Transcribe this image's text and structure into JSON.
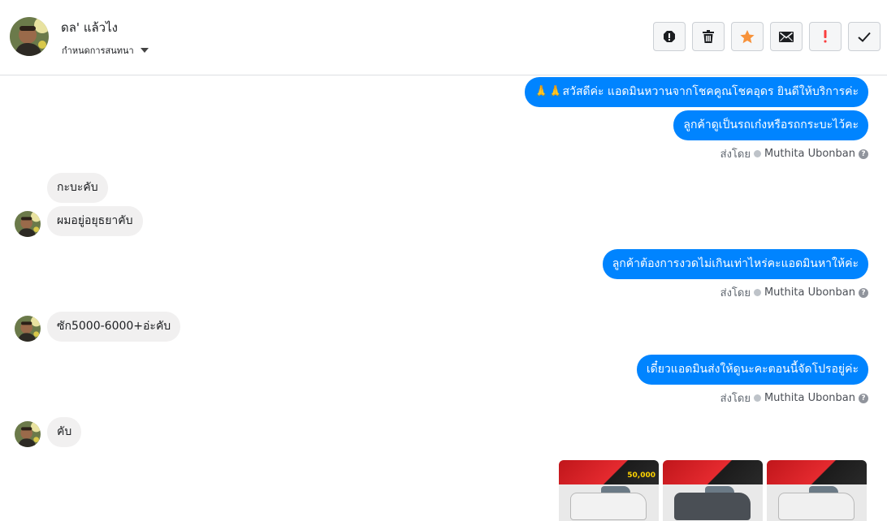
{
  "header": {
    "contact_name": "ดล' แล้วไง",
    "subtitle": "กำหนดการสนทนา",
    "toolbar": [
      {
        "name": "spam-alert-icon",
        "color": "#1c1e21"
      },
      {
        "name": "trash-icon",
        "color": "#1c1e21"
      },
      {
        "name": "star-icon",
        "color": "#f7923a"
      },
      {
        "name": "mail-icon",
        "color": "#1c1e21"
      },
      {
        "name": "exclamation-icon",
        "color": "#fa3e3e"
      },
      {
        "name": "check-icon",
        "color": "#1c1e21"
      }
    ]
  },
  "messages": {
    "out1": "🙏🙏สวัสดีค่ะ แอดมินหวานจากโชคคูณโชคอุดร ยินดีให้บริการค่ะ",
    "out2": "ลูกค้าดูเป็นรถเก๋งหรือรถกระบะไว้คะ",
    "sent_by_1_label": "ส่งโดย",
    "sent_by_1_name": "Muthita Ubonban",
    "in1": "กะบะคับ",
    "in2": "ผมอยู่อยุธยาคับ",
    "out3": "ลูกค้าต้องการงวดไม่เกินเท่าไหร่คะแอดมินหาให้ค่ะ",
    "sent_by_2_label": "ส่งโดย",
    "sent_by_2_name": "Muthita Ubonban",
    "in3": "ซัก5000-6000+อ่ะคับ",
    "out4": "เดี๋ยวแอดมินส่งให้ดูนะคะตอนนี้จัดโปรอยู่ค่ะ",
    "sent_by_3_label": "ส่งโดย",
    "sent_by_3_name": "Muthita Ubonban",
    "in4": "คับ"
  },
  "attachments": {
    "thumb1_price": "50,000",
    "car_colors": [
      "#f2f2f2",
      "#4a4f55",
      "#f0f0f0"
    ]
  },
  "colors": {
    "outgoing_bubble": "#0084ff",
    "incoming_bubble": "#f1f0f0"
  }
}
